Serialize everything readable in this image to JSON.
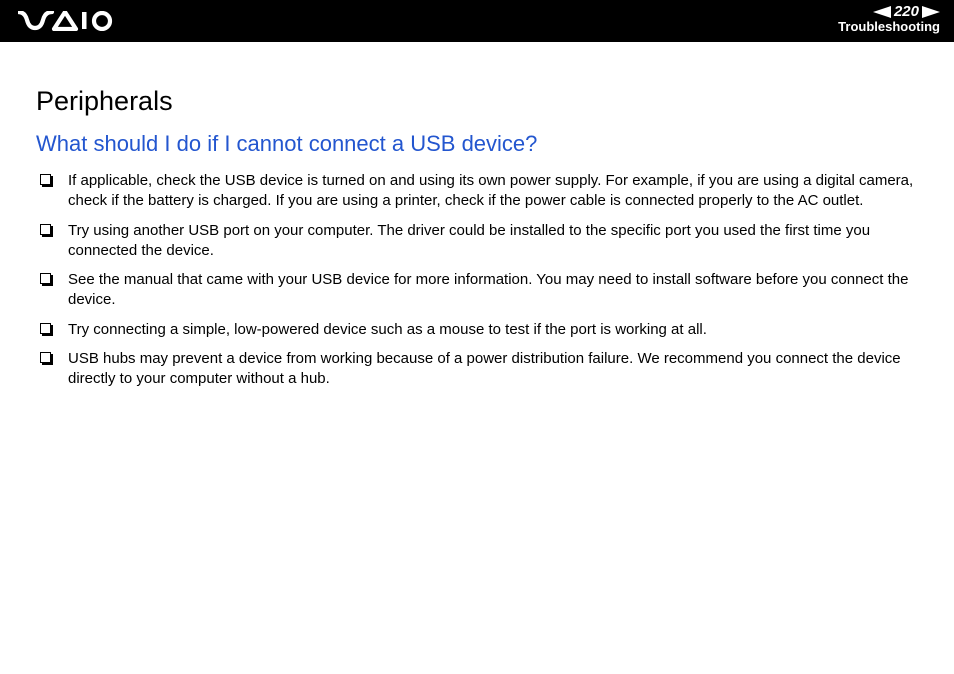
{
  "header": {
    "page_number": "220",
    "section": "Troubleshooting"
  },
  "content": {
    "title": "Peripherals",
    "subtitle": "What should I do if I cannot connect a USB device?",
    "items": [
      "If applicable, check the USB device is turned on and using its own power supply. For example, if you are using a digital camera, check if the battery is charged. If you are using a printer, check if the power cable is connected properly to the AC outlet.",
      "Try using another USB port on your computer. The driver could be installed to the specific port you used the first time you connected the device.",
      "See the manual that came with your USB device for more information. You may need to install software before you connect the device.",
      "Try connecting a simple, low-powered device such as a mouse to test if the port is working at all.",
      "USB hubs may prevent a device from working because of a power distribution failure. We recommend you connect the device directly to your computer without a hub."
    ]
  }
}
